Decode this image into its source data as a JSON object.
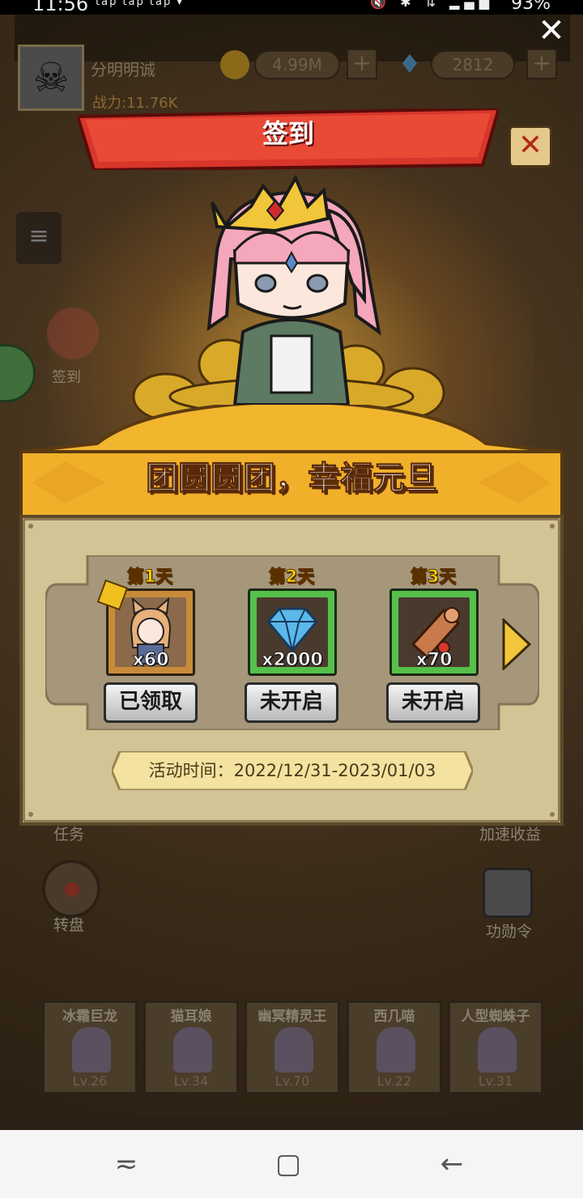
{
  "status_bar": {
    "time": "11:56",
    "notifications": "tap tap tap ▾",
    "system_icons": "🔇 ✱ ⇅ ▂▄▆",
    "battery": "93%"
  },
  "game": {
    "player_name": "分明明诚",
    "power_label": "战力:11.76K",
    "gold": "4.99M",
    "gems": "2812",
    "left_signin_label": "签到",
    "bg_labels": {
      "task": "任务",
      "speed_up": "加速收益",
      "wheel": "转盘",
      "merit": "功勋令"
    },
    "heroes": [
      {
        "name": "冰霜巨龙",
        "level": "Lv.26"
      },
      {
        "name": "猫耳娘",
        "level": "Lv.34"
      },
      {
        "name": "幽冥精灵王",
        "level": "Lv.70"
      },
      {
        "name": "西几喵",
        "level": "Lv.22"
      },
      {
        "name": "人型蜘蛛子",
        "level": "Lv.31"
      }
    ]
  },
  "popup": {
    "title": "签到",
    "subtitle": "团圆圆团，幸福元旦",
    "event_time": "活动时间：2022/12/31-2023/01/03",
    "rewards": [
      {
        "day": "第1天",
        "quantity": "x60",
        "item_icon": "cat-girl-hero-icon",
        "button": "已领取",
        "frame_color": "#c98b3a"
      },
      {
        "day": "第2天",
        "quantity": "x2000",
        "item_icon": "diamond-icon",
        "button": "未开启",
        "frame_color": "#55c04a"
      },
      {
        "day": "第3天",
        "quantity": "x70",
        "item_icon": "scroll-icon",
        "button": "未开启",
        "frame_color": "#55c04a"
      }
    ]
  },
  "nav": {
    "recent": "≂",
    "home": "▢",
    "back": "←"
  },
  "icons": {
    "close_overlay": "✕",
    "popup_close": "✕",
    "menu": "≡",
    "plus": "+",
    "skull": "☠"
  }
}
